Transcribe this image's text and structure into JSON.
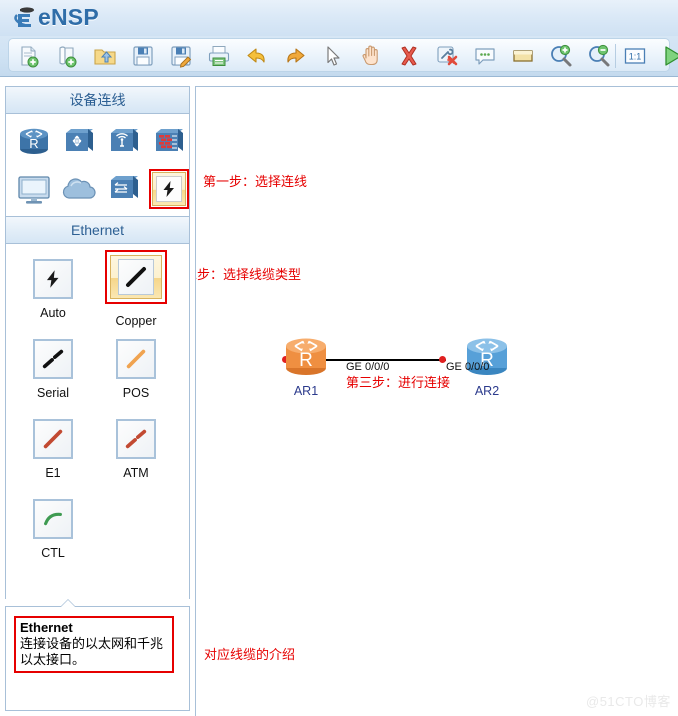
{
  "app": {
    "title": "eNSP",
    "logo_icon": "ensp-logo-icon"
  },
  "toolbar": {
    "buttons": [
      {
        "name": "new-topology-button",
        "icon": "new-document-icon",
        "tooltip": "New Topology"
      },
      {
        "name": "open-topology-button",
        "icon": "open-scroll-icon",
        "tooltip": "Open"
      },
      {
        "name": "open-folder-button",
        "icon": "folder-up-icon",
        "tooltip": "Open Folder"
      },
      {
        "name": "save-button",
        "icon": "floppy-disk-icon",
        "tooltip": "Save"
      },
      {
        "name": "save-as-button",
        "icon": "floppy-pencil-icon",
        "tooltip": "Save As"
      },
      {
        "name": "print-button",
        "icon": "printer-icon",
        "tooltip": "Print"
      },
      {
        "name": "undo-button",
        "icon": "undo-arrow-icon",
        "tooltip": "Undo"
      },
      {
        "name": "redo-button",
        "icon": "redo-arrow-icon",
        "tooltip": "Redo"
      },
      {
        "name": "select-tool-button",
        "icon": "cursor-arrow-icon",
        "tooltip": "Select"
      },
      {
        "name": "pan-tool-button",
        "icon": "hand-icon",
        "tooltip": "Pan"
      },
      {
        "name": "delete-button",
        "icon": "red-x-icon",
        "tooltip": "Delete"
      },
      {
        "name": "delete-link-button",
        "icon": "wrench-delete-icon",
        "tooltip": "Remove Configuration"
      },
      {
        "name": "add-note-button",
        "icon": "speech-bubble-icon",
        "tooltip": "Add Note"
      },
      {
        "name": "add-shape-button",
        "icon": "rectangle-shape-icon",
        "tooltip": "Add Shape"
      },
      {
        "name": "zoom-in-button",
        "icon": "magnifier-plus-icon",
        "tooltip": "Zoom In"
      },
      {
        "name": "zoom-out-button",
        "icon": "magnifier-minus-icon",
        "tooltip": "Zoom Out"
      },
      {
        "name": "zoom-actual-button",
        "icon": "one-to-one-icon",
        "tooltip": "1:1"
      },
      {
        "name": "start-all-button",
        "icon": "green-play-icon",
        "tooltip": "Start All Devices"
      }
    ]
  },
  "sidebar": {
    "device_panel": {
      "title": "设备连线",
      "devices": [
        {
          "name": "device-router",
          "icon": "router-icon",
          "selected": false
        },
        {
          "name": "device-switch",
          "icon": "switch-icon",
          "selected": false
        },
        {
          "name": "device-wlan",
          "icon": "wireless-ap-icon",
          "selected": false
        },
        {
          "name": "device-firewall",
          "icon": "firewall-icon",
          "selected": false
        },
        {
          "name": "device-endpoint",
          "icon": "pc-monitor-icon",
          "selected": false
        },
        {
          "name": "device-cloud",
          "icon": "cloud-icon",
          "selected": false
        },
        {
          "name": "device-lan-switch",
          "icon": "lan-switch-icon",
          "selected": false
        },
        {
          "name": "device-connection",
          "icon": "lightning-bolt-icon",
          "selected": true
        }
      ]
    },
    "cable_panel": {
      "title": "Ethernet",
      "cables": [
        {
          "name": "cable-auto",
          "label": "Auto",
          "icon": "lightning-bolt-icon",
          "color": "#111111",
          "selected": false
        },
        {
          "name": "cable-copper",
          "label": "Copper",
          "icon": "straight-cable-icon",
          "color": "#111111",
          "selected": true
        },
        {
          "name": "cable-serial",
          "label": "Serial",
          "icon": "segmented-cable-icon",
          "color": "#111111",
          "selected": false
        },
        {
          "name": "cable-pos",
          "label": "POS",
          "icon": "straight-cable-icon",
          "color": "#f0a350",
          "selected": false
        },
        {
          "name": "cable-e1",
          "label": "E1",
          "icon": "straight-cable-icon",
          "color": "#c24a32",
          "selected": false
        },
        {
          "name": "cable-atm",
          "label": "ATM",
          "icon": "segmented-cable-icon",
          "color": "#c24a32",
          "selected": false
        },
        {
          "name": "cable-ctl",
          "label": "CTL",
          "icon": "curved-cable-icon",
          "color": "#3f9b52",
          "selected": false
        }
      ]
    },
    "description": {
      "title": "Ethernet",
      "body": "连接设备的以太网和千兆以太接口。"
    }
  },
  "canvas": {
    "annotations": [
      {
        "name": "annotation-step-1",
        "text": "第一步：选择连线"
      },
      {
        "name": "annotation-step-2",
        "text": "第二步：选择线缆类型"
      },
      {
        "name": "annotation-step-3",
        "text": "第三步：进行连接"
      },
      {
        "name": "annotation-cable-description",
        "text": "对应线缆的介绍"
      }
    ],
    "topology": {
      "devices": [
        {
          "name": "topology-router-ar1",
          "label": "AR1",
          "badge": "R",
          "color": "#f08a3c",
          "interface": "GE 0/0/0"
        },
        {
          "name": "topology-router-ar2",
          "label": "AR2",
          "badge": "R",
          "color": "#4f9fd8",
          "interface": "GE 0/0/0"
        }
      ],
      "link": {
        "name": "topology-link",
        "status_color": "#e02020"
      }
    }
  },
  "watermark": {
    "text": "@51CTO博客"
  },
  "colors": {
    "accent": "#2c5f93",
    "highlight_red": "#e60000",
    "selection_yellow": "#f7d98a",
    "panel_border": "#a8c0d8"
  }
}
